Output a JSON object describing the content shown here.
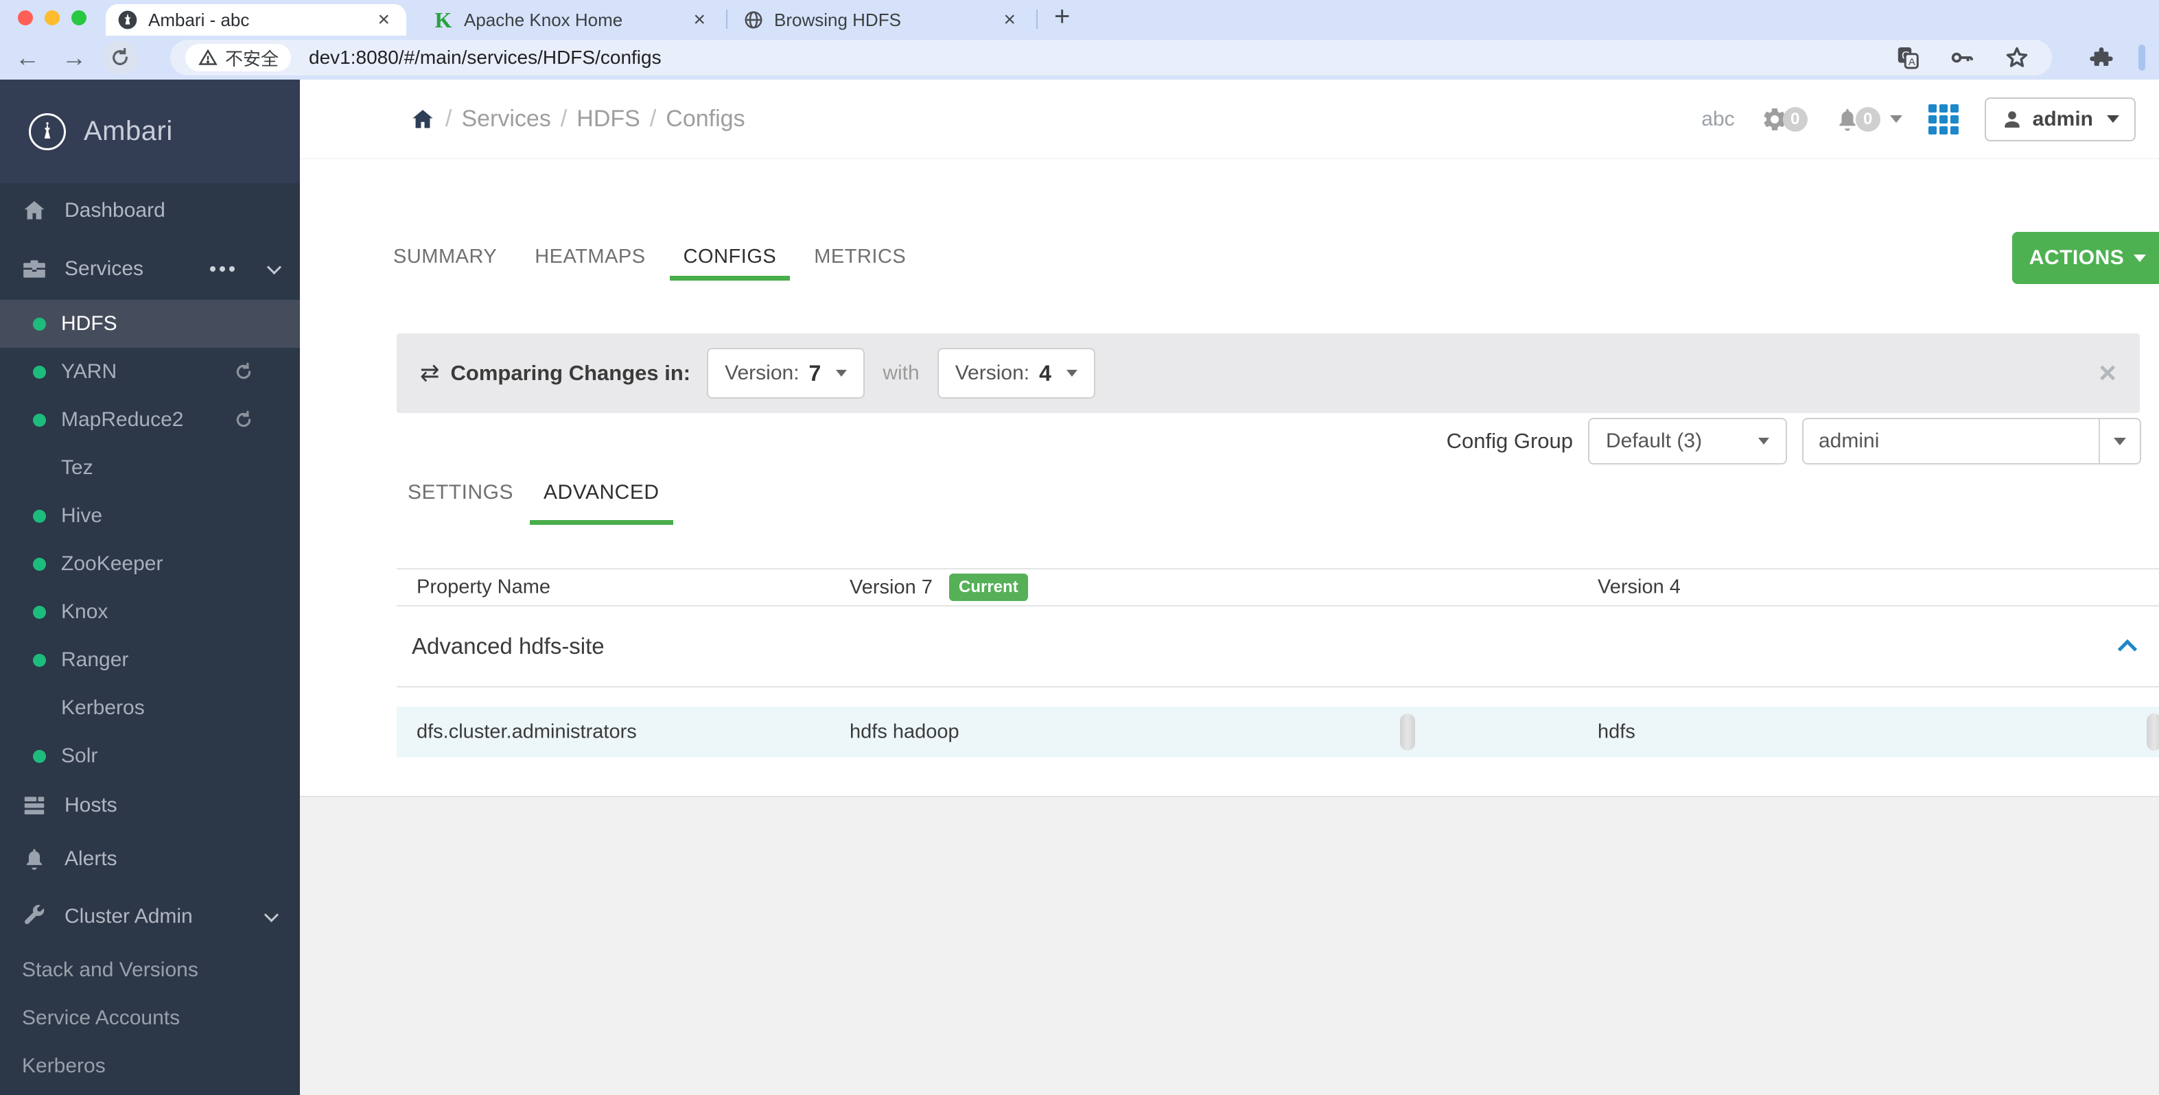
{
  "browser": {
    "tabs": [
      {
        "title": "Ambari - abc",
        "favicon": "ambari"
      },
      {
        "title": "Apache Knox Home",
        "favicon": "knox"
      },
      {
        "title": "Browsing HDFS",
        "favicon": "globe"
      }
    ],
    "close_glyph": "×",
    "new_tab_glyph": "+",
    "back_glyph": "←",
    "forward_glyph": "→",
    "security_label": "不安全",
    "url": "dev1:8080/#/main/services/HDFS/configs"
  },
  "sidebar": {
    "brand": "Ambari",
    "top_items": [
      {
        "label": "Dashboard",
        "icon": "home-icon"
      },
      {
        "label": "Services",
        "icon": "briefcase-icon"
      }
    ],
    "services": [
      {
        "label": "HDFS"
      },
      {
        "label": "YARN"
      },
      {
        "label": "MapReduce2"
      },
      {
        "label": "Tez"
      },
      {
        "label": "Hive"
      },
      {
        "label": "ZooKeeper"
      },
      {
        "label": "Knox"
      },
      {
        "label": "Ranger"
      },
      {
        "label": "Kerberos"
      },
      {
        "label": "Solr"
      }
    ],
    "bottom_items": [
      {
        "label": "Hosts",
        "icon": "hosts-icon"
      },
      {
        "label": "Alerts",
        "icon": "bell-icon"
      },
      {
        "label": "Cluster Admin",
        "icon": "wrench-icon"
      }
    ],
    "admin_subitems": [
      {
        "label": "Stack and Versions"
      },
      {
        "label": "Service Accounts"
      },
      {
        "label": "Kerberos"
      }
    ]
  },
  "header": {
    "breadcrumb": {
      "separator": "/",
      "items": [
        "Services",
        "HDFS",
        "Configs"
      ]
    },
    "cluster_name": "abc",
    "ops_badge": "0",
    "alerts_badge": "0",
    "user_label": "admin"
  },
  "service_nav": {
    "tabs": [
      {
        "label": "SUMMARY"
      },
      {
        "label": "HEATMAPS"
      },
      {
        "label": "CONFIGS"
      },
      {
        "label": "METRICS"
      }
    ],
    "actions_label": "ACTIONS"
  },
  "compare_bar": {
    "icon_glyph": "⇄",
    "label": "Comparing Changes in:",
    "left_version": {
      "label": "Version:",
      "value": "7"
    },
    "conjunction": "with",
    "right_version": {
      "label": "Version:",
      "value": "4"
    },
    "close_glyph": "×"
  },
  "config_group": {
    "label": "Config Group",
    "selected": "Default (3)",
    "filter_value": "admini"
  },
  "config_tabs": [
    {
      "label": "SETTINGS"
    },
    {
      "label": "ADVANCED"
    }
  ],
  "config_table": {
    "columns": {
      "property": "Property Name",
      "v7": "Version 7",
      "v7_badge": "Current",
      "v4": "Version 4"
    },
    "section_title": "Advanced hdfs-site",
    "rows": [
      {
        "property": "dfs.cluster.administrators",
        "v7_value": "hdfs hadoop",
        "v4_value": "hdfs"
      }
    ]
  },
  "colors": {
    "accent_green": "#4eb151",
    "badge_green": "#55b057",
    "sidebar_bg": "#2c3748",
    "sidebar_brand_bg": "#333e55",
    "selected_item_bg": "#454d5c",
    "service_ok_dot": "#1dbc7c",
    "row_highlight": "#edf6f9",
    "grid_icon_blue": "#1c87c9",
    "section_chevron_blue": "#1d86c8"
  }
}
